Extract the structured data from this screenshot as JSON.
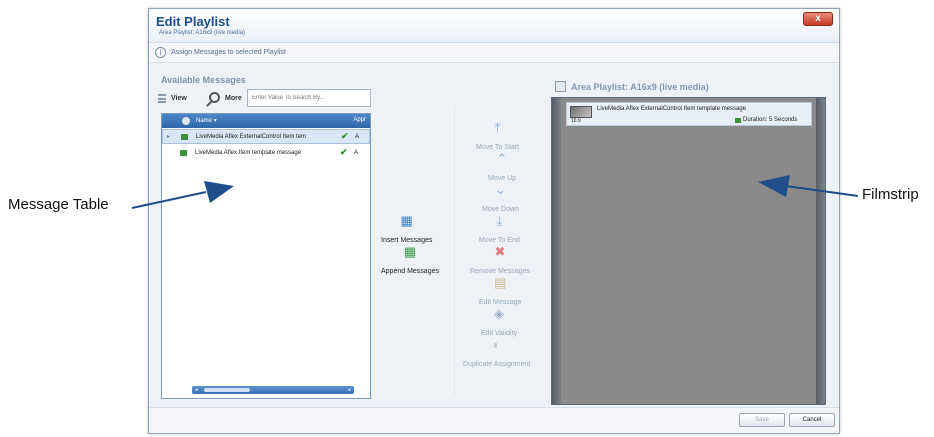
{
  "callouts": {
    "message_table": "Message Table",
    "filmstrip": "Filmstrip"
  },
  "dialog": {
    "title": "Edit Playlist",
    "subtitle": "Area Playlist: A16x9 (live media)",
    "close_label": "x",
    "assign_label": "Assign Messages to selected Playlist"
  },
  "available": {
    "title": "Available Messages",
    "view_label": "View",
    "more_label": "More",
    "search_placeholder": "Enter Value To Search By...",
    "columns": {
      "name": "Name",
      "approved": "Appr"
    },
    "rows": [
      {
        "name": "LiveMedia Aflex ExternalControl Item tem",
        "approved": "A"
      },
      {
        "name": "LiveMedia Aflex Item template message",
        "approved": "A"
      }
    ]
  },
  "actions": {
    "insert": "Insert Messages",
    "append": "Append Messages",
    "move_to_start": "Move To Start",
    "move_up": "Move Up",
    "move_down": "Move Down",
    "move_to_end": "Move To End",
    "remove": "Remove Messages",
    "edit_message": "Edit Message",
    "edit_validity": "Edit Validity",
    "duplicate": "Duplicate Assignment"
  },
  "playlist": {
    "title": "Area Playlist: A16x9 (live media)",
    "items": [
      {
        "name": "LiveMedia Aflex ExternalControl Item template message",
        "ratio": "16:9",
        "duration": "Duration: 5 Seconds"
      }
    ]
  },
  "footer": {
    "save": "Save",
    "cancel": "Cancel"
  },
  "colors": {
    "accent": "#2f66aa",
    "title": "#1d4f8d",
    "filmstrip_bg": "#8a8a8a",
    "callout_arrow": "#1f4e8a"
  }
}
